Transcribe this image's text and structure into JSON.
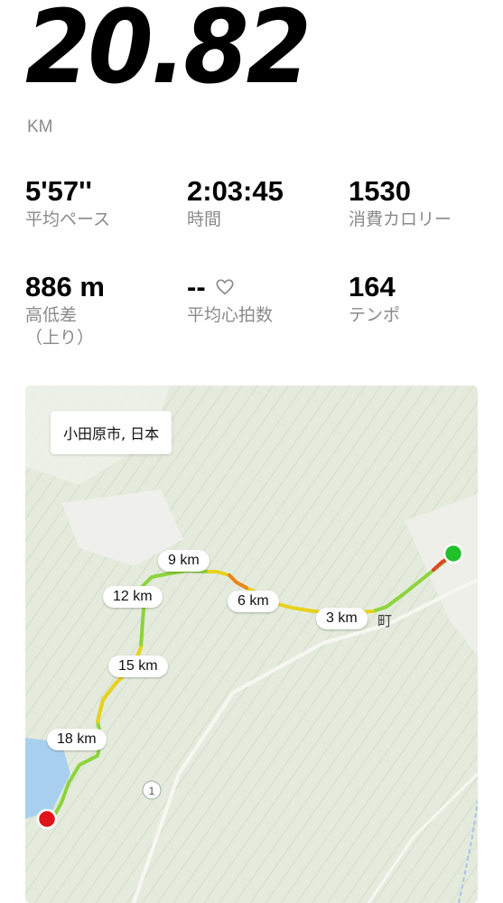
{
  "summary": {
    "distance": "20.82",
    "unit": "KM"
  },
  "stats": {
    "pace": {
      "value": "5'57''",
      "label": "平均ペース"
    },
    "time": {
      "value": "2:03:45",
      "label": "時間"
    },
    "calories": {
      "value": "1530",
      "label": "消費カロリー"
    },
    "elevation": {
      "value": "886 m",
      "label": "高低差",
      "label2": "（上り）"
    },
    "heart_rate": {
      "value": "--",
      "label": "平均心拍数",
      "icon": "heart-outline-icon"
    },
    "cadence": {
      "value": "164",
      "label": "テンポ"
    }
  },
  "map": {
    "location": "小田原市, 日本",
    "town_label": "町",
    "road_number": "1",
    "markers": [
      "3 km",
      "6 km",
      "9 km",
      "12 km",
      "15 km",
      "18 km"
    ],
    "colors": {
      "start": "#22c02a",
      "end": "#e0141b",
      "route_green": "#8cd43a",
      "route_yellow": "#e7d21c",
      "route_orange": "#e8861c",
      "route_red": "#e2452a"
    }
  }
}
